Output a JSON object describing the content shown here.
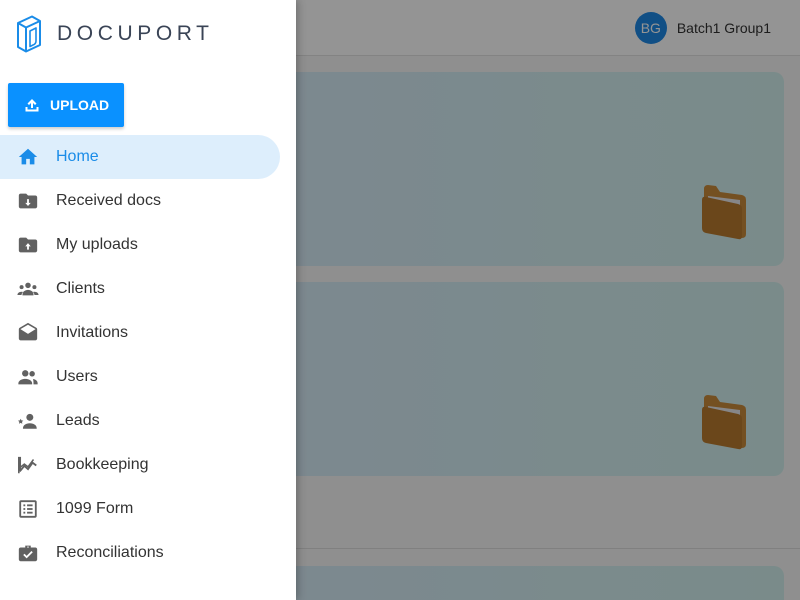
{
  "header": {
    "user": {
      "initials": "BG",
      "name": "Batch1 Group1"
    }
  },
  "sidebar": {
    "logo_text": "DOCUPORT",
    "upload_label": "UPLOAD",
    "items": [
      {
        "label": "Home",
        "icon": "home-icon",
        "active": true
      },
      {
        "label": "Received docs",
        "icon": "folder-download-icon"
      },
      {
        "label": "My uploads",
        "icon": "folder-upload-icon"
      },
      {
        "label": "Clients",
        "icon": "group-icon"
      },
      {
        "label": "Invitations",
        "icon": "envelope-open-icon"
      },
      {
        "label": "Users",
        "icon": "users-icon"
      },
      {
        "label": "Leads",
        "icon": "person-star-icon"
      },
      {
        "label": "Bookkeeping",
        "icon": "chart-icon"
      },
      {
        "label": "1099 Form",
        "icon": "list-form-icon"
      },
      {
        "label": "Reconciliations",
        "icon": "briefcase-check-icon"
      }
    ]
  },
  "colors": {
    "accent": "#0a91ff",
    "active_bg": "#ddeefc",
    "avatar": "#1e88e5"
  }
}
